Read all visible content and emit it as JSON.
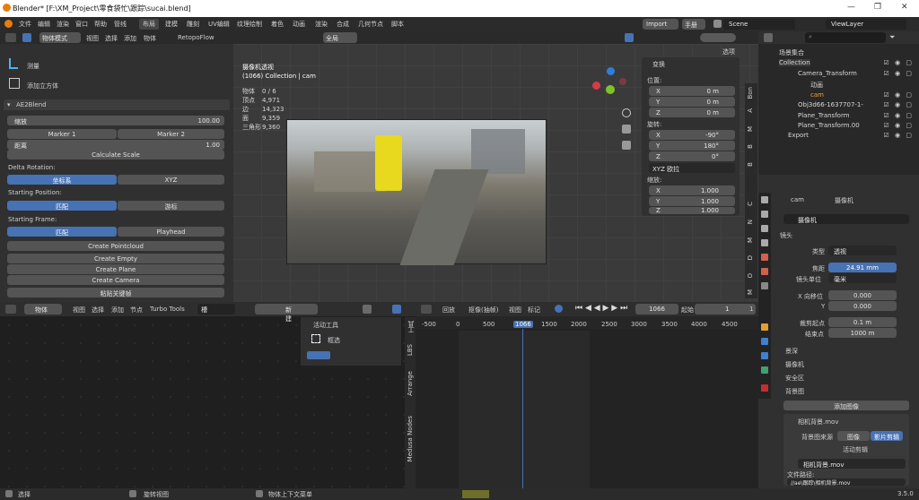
{
  "window": {
    "title": "Blender* [F:\\XM_Project\\零食袋忙\\跟踪\\sucai.blend]"
  },
  "menu": {
    "items": [
      "文件",
      "编辑",
      "渲染",
      "窗口",
      "帮助",
      "管线"
    ],
    "tabs": [
      "布局",
      "建模",
      "雕刻",
      "UV编辑",
      "纹理绘制",
      "着色",
      "动画",
      "渲染",
      "合成",
      "几何节点",
      "脚本"
    ],
    "active_tab": "布局",
    "import": "Import",
    "import2": "手册",
    "scene": "Scene",
    "viewlayer": "ViewLayer"
  },
  "vp_header": {
    "mode": "物体模式",
    "menus": [
      "视图",
      "选择",
      "添加",
      "物体"
    ],
    "retopo": "RetopoFlow",
    "global": "全局",
    "options": "选项"
  },
  "left_tools": {
    "measure": "测量",
    "add_cube": "添加立方体"
  },
  "ae2blend": {
    "title": "AE2Blend",
    "scale_label": "缩放",
    "scale_value": "100.00",
    "marker1": "Marker 1",
    "marker2": "Marker 2",
    "distance_label": "距离",
    "distance_value": "1.00",
    "calc_scale": "Calculate Scale",
    "delta_rotation": "Delta Rotation:",
    "dr_a": "坐标系",
    "dr_b": "XYZ",
    "starting_position": "Starting Position:",
    "sp_a": "匹配",
    "sp_b": "游标",
    "starting_frame": "Starting Frame:",
    "sf_a": "匹配",
    "sf_b": "Playhead",
    "create_pointcloud": "Create Pointcloud",
    "create_empty": "Create Empty",
    "create_plane": "Create Plane",
    "create_camera": "Create Camera",
    "paste_keys": "粘贴关键帧"
  },
  "viewport": {
    "title": "摄像机透视",
    "subtitle": "(1066) Collection | cam",
    "stats": [
      [
        "物体",
        "0 / 6"
      ],
      [
        "顶点",
        "4,971"
      ],
      [
        "边",
        "14,323"
      ],
      [
        "面",
        "9,359"
      ],
      [
        "三角形",
        "9,360"
      ]
    ]
  },
  "transform": {
    "title": "变换",
    "location": "位置:",
    "loc": [
      [
        "X",
        "0 m"
      ],
      [
        "Y",
        "0 m"
      ],
      [
        "Z",
        "0 m"
      ]
    ],
    "rotation": "旋转:",
    "rot": [
      [
        "X",
        "-90°"
      ],
      [
        "Y",
        "180°"
      ],
      [
        "Z",
        "0°"
      ]
    ],
    "euler": "XYZ 欧拉",
    "scale": "缩放:",
    "scl": [
      [
        "X",
        "1.000"
      ],
      [
        "Y",
        "1.000"
      ],
      [
        "Z",
        "1.000"
      ]
    ]
  },
  "side_tabs": [
    "Bon",
    "A",
    "M",
    "B",
    "B",
    "C",
    "N",
    "M",
    "D",
    "O",
    "M"
  ],
  "outliner": {
    "search_placeholder": "",
    "items": [
      "场景集合",
      "Collection",
      "Camera_Transform",
      "动画",
      "cam",
      "Obj3d66-1637707-1-",
      "Plane_Transform",
      "Plane_Transform.00",
      "Export"
    ]
  },
  "properties": {
    "breadcrumb_a": "cam",
    "breadcrumb_b": "摄像机",
    "data_name": "摄像机",
    "lens": "镜头",
    "type_label": "类型",
    "type_value": "透视",
    "fov_label": "焦距",
    "fov_value": "24.91 mm",
    "unit_label": "镜头单位",
    "unit_value": "毫米",
    "shiftx_label": "X 向移位",
    "shiftx_value": "0.000",
    "shifty_label": "Y",
    "shifty_value": "0.000",
    "clip_start_label": "裁剪起点",
    "clip_start_value": "0.1 m",
    "clip_end_label": "结束点",
    "clip_end_value": "1000 m",
    "dof": "景深",
    "camera": "摄像机",
    "safe": "安全区",
    "bg": "背景图",
    "add_image": "添加图像",
    "bg_item": "相机背景.mov",
    "source_label": "背景图来源",
    "src_image": "图像",
    "src_clip": "影片剪辑",
    "active_clip": "活动剪辑",
    "clip_name": "相机背景.mov",
    "file_path": "文件路径:",
    "path_value": "//ae\\跟踪\\相机背景.mov"
  },
  "node_header": {
    "type": "物体",
    "menus": [
      "视图",
      "选择",
      "添加",
      "节点",
      "Turbo Tools"
    ],
    "slot": "槽",
    "new": "新建"
  },
  "active_tool": {
    "title": "活动工具",
    "tool": "框选"
  },
  "node_side_tabs": [
    "工具",
    "LBS",
    "Arrange",
    "Medusa Nodes"
  ],
  "timeline": {
    "menus": [
      "回放",
      "抠像(抽帧)",
      "视图",
      "标记"
    ],
    "frame": "1066",
    "start_label": "起始",
    "start": "1",
    "end": "1",
    "ticks": [
      "-500",
      "0",
      "500",
      "1066",
      "1500",
      "2000",
      "2500",
      "3000",
      "3500",
      "4000",
      "4500"
    ]
  },
  "status": {
    "select": "选择",
    "rotate": "旋转视图",
    "ctx": "物体上下文菜单",
    "version": "3.5.0"
  }
}
